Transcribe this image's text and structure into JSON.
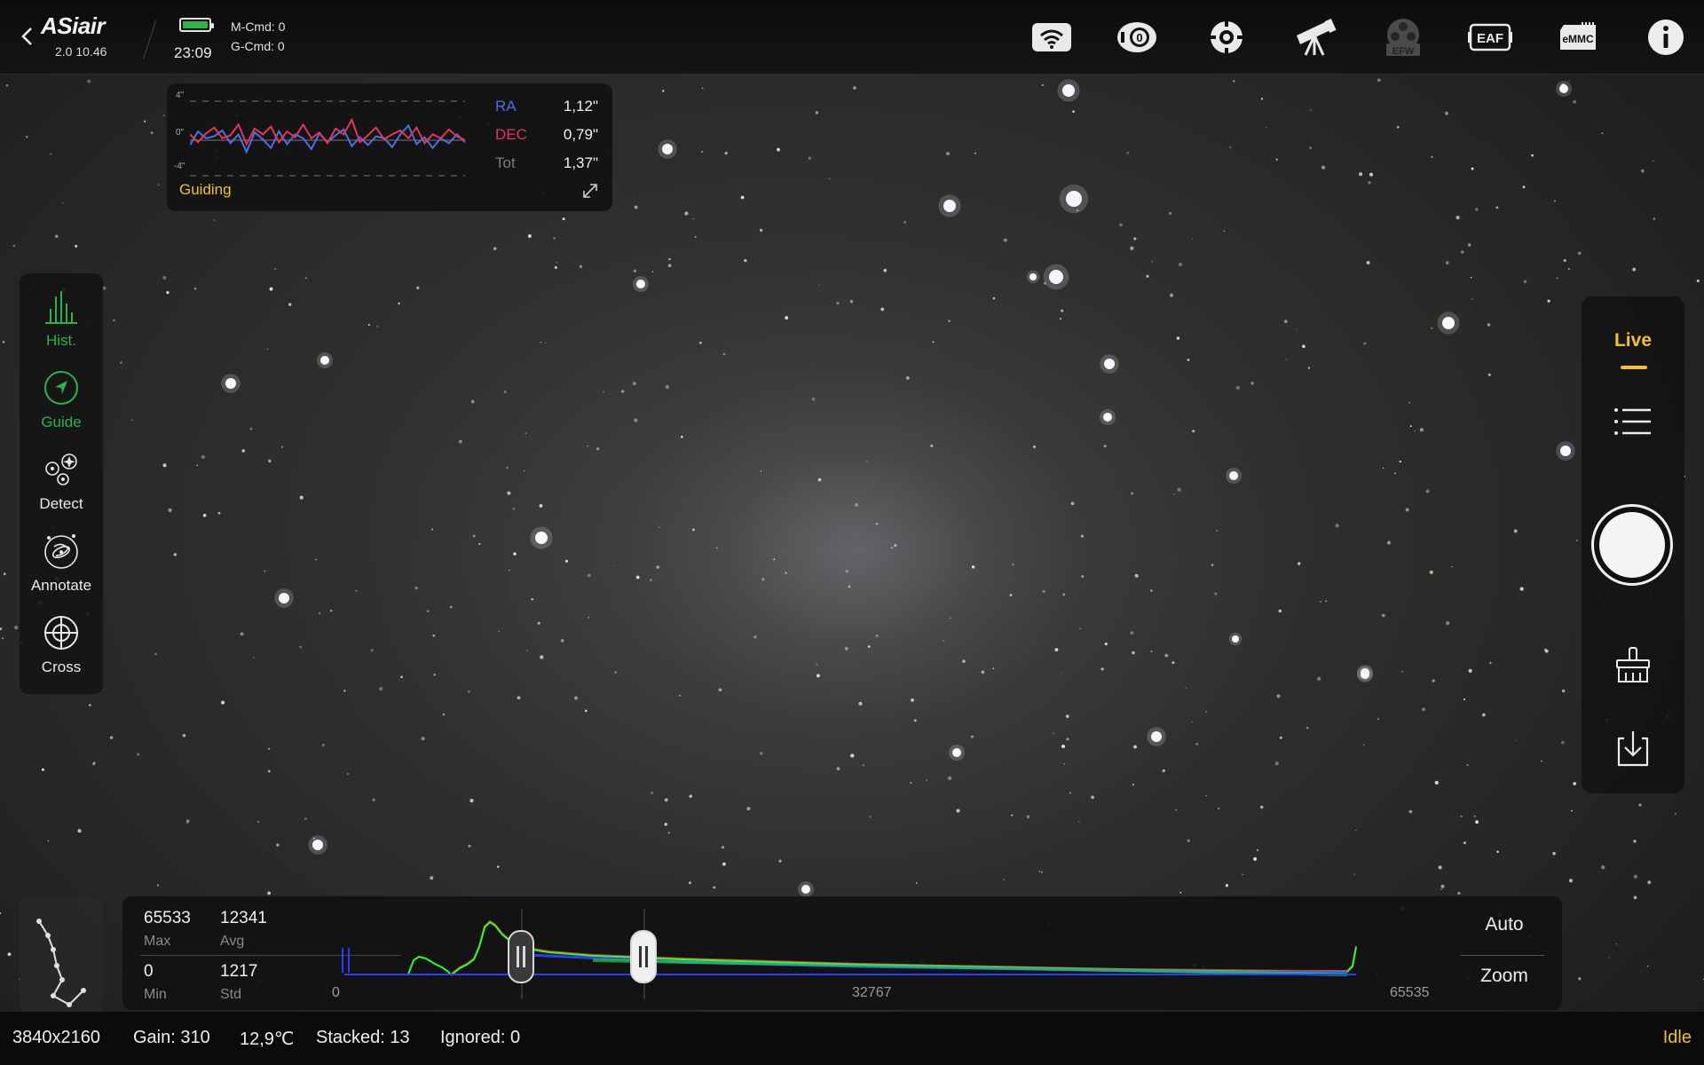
{
  "app": {
    "logo": "ASiair",
    "version": "2.0 10.46"
  },
  "header": {
    "time": "23:09",
    "m_cmd": "M-Cmd: 0",
    "g_cmd": "G-Cmd: 0",
    "icons": [
      "wifi-icon",
      "camera-icon",
      "guide-scope-icon",
      "telescope-icon",
      "efw-icon",
      "eaf-icon",
      "emmc-icon",
      "info-icon"
    ],
    "efw_label": "EFW",
    "eaf_label": "EAF",
    "emmc_label": "eMMC"
  },
  "guiding": {
    "title": "Guiding",
    "y_labels": [
      "4\"",
      "0\"",
      "-4\""
    ],
    "ra_label": "RA",
    "ra_value": "1,12\"",
    "ra_color": "#4a6fe8",
    "dec_label": "DEC",
    "dec_value": "0,79\"",
    "dec_color": "#e8335a",
    "tot_label": "Tot",
    "tot_value": "1,37\"",
    "ra_series": [
      -0.5,
      0.9,
      0.2,
      0.4,
      1.0,
      -0.3,
      0.6,
      -1.2,
      0.8,
      0.1,
      -0.8,
      0.9,
      -0.4,
      0.6,
      0.2,
      -0.9,
      0.7,
      -0.2,
      0.5,
      1.1,
      -0.6,
      0.3,
      -0.5,
      0.4,
      0.2,
      -0.7,
      0.6,
      1.5,
      -0.4,
      0.3,
      -0.8,
      0.2,
      -0.3,
      0.6,
      -0.2
    ],
    "dec_series": [
      0.6,
      -0.2,
      0.7,
      1.3,
      0.2,
      0.5,
      1.6,
      -0.4,
      1.2,
      0.6,
      1.4,
      -0.2,
      0.9,
      0.3,
      1.6,
      0.2,
      0.8,
      -0.3,
      1.2,
      0.6,
      2.1,
      -0.2,
      0.5,
      1.3,
      0.1,
      0.6,
      1.0,
      0.2,
      1.3,
      -0.3,
      0.6,
      0.2,
      1.1,
      0.4,
      0.0
    ]
  },
  "tools": [
    {
      "label": "Hist.",
      "active": true
    },
    {
      "label": "Guide",
      "active": true
    },
    {
      "label": "Detect",
      "active": false
    },
    {
      "label": "Annotate",
      "active": false
    },
    {
      "label": "Cross",
      "active": false
    }
  ],
  "right_panel": {
    "mode": "Live"
  },
  "histogram": {
    "max_value": "65533",
    "max_label": "Max",
    "avg_value": "12341",
    "avg_label": "Avg",
    "min_value": "0",
    "min_label": "Min",
    "std_value": "1217",
    "std_label": "Std",
    "tick_min": "0",
    "tick_mid": "32767",
    "tick_max": "65535",
    "auto_label": "Auto",
    "zoom_label": "Zoom"
  },
  "status": {
    "resolution": "3840x2160",
    "gain": "Gain: 310",
    "temperature": "12,9℃",
    "stacked": "Stacked: 13",
    "ignored": "Ignored: 0",
    "state": "Idle"
  }
}
